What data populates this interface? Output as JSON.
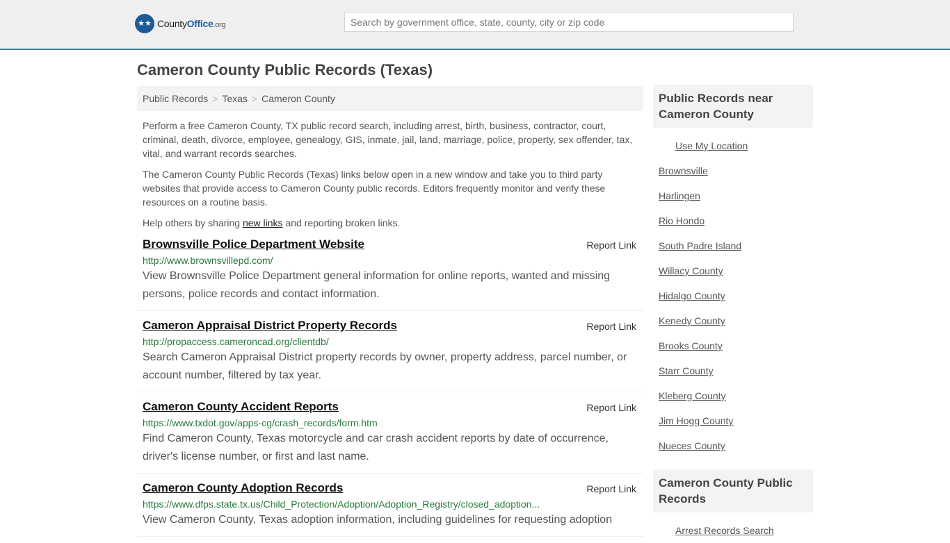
{
  "header": {
    "logo": {
      "name": "County",
      "office": "Office",
      "tld": ".org",
      "icon": "eagle-stars-icon"
    },
    "search": {
      "placeholder": "Search by government office, state, county, city or zip code",
      "value": ""
    }
  },
  "page_title": "Cameron County Public Records (Texas)",
  "breadcrumb": [
    {
      "label": "Public Records"
    },
    {
      "label": "Texas"
    },
    {
      "label": "Cameron County"
    }
  ],
  "breadcrumb_separator": ">",
  "intro": {
    "p1": "Perform a free Cameron County, TX public record search, including arrest, birth, business, contractor, court, criminal, death, divorce, employee, genealogy, GIS, inmate, jail, land, marriage, police, property, sex offender, tax, vital, and warrant records searches.",
    "p2": "The Cameron County Public Records (Texas) links below open in a new window and take you to third party websites that provide access to Cameron County public records. Editors frequently monitor and verify these resources on a routine basis.",
    "p3_before": "Help others by sharing ",
    "p3_link": "new links",
    "p3_after": " and reporting broken links."
  },
  "report_label": "Report Link",
  "records": [
    {
      "title": "Brownsville Police Department Website",
      "url": "http://www.brownsvillepd.com/",
      "description": "View Brownsville Police Department general information for online reports, wanted and missing persons, police records and contact information."
    },
    {
      "title": "Cameron Appraisal District Property Records",
      "url": "http://propaccess.cameroncad.org/clientdb/",
      "description": "Search Cameron Appraisal District property records by owner, property address, parcel number, or account number, filtered by tax year."
    },
    {
      "title": "Cameron County Accident Reports",
      "url": "https://www.txdot.gov/apps-cg/crash_records/form.htm",
      "description": "Find Cameron County, Texas motorcycle and car crash accident reports by date of occurrence, driver's license number, or first and last name."
    },
    {
      "title": "Cameron County Adoption Records",
      "url": "https://www.dfps.state.tx.us/Child_Protection/Adoption/Adoption_Registry/closed_adoption...",
      "description": "View Cameron County, Texas adoption information, including guidelines for requesting adoption"
    }
  ],
  "sidebar": {
    "nearby_heading": "Public Records near Cameron County",
    "use_location": "Use My Location",
    "nearby": [
      "Brownsville",
      "Harlingen",
      "Rio Hondo",
      "South Padre Island",
      "Willacy County",
      "Hidalgo County",
      "Kenedy County",
      "Brooks County",
      "Starr County",
      "Kleberg County",
      "Jim Hogg County",
      "Nueces County"
    ],
    "county_heading": "Cameron County Public Records",
    "county_links": [
      "Arrest Records Search"
    ]
  },
  "colors": {
    "accent_border": "#3a7bad",
    "url_green": "#287a3c",
    "logo_blue": "#1e5a96"
  }
}
